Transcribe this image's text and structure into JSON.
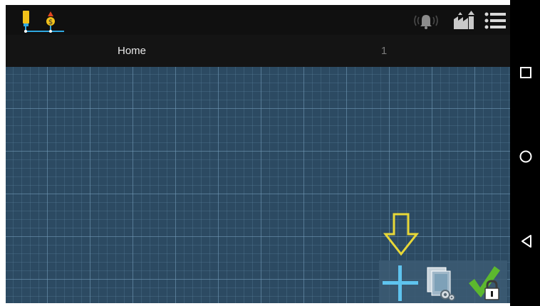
{
  "tabs": [
    {
      "label": "Home",
      "active": true
    },
    {
      "label": "1",
      "active": false
    }
  ],
  "icons": {
    "app_logo": "app-logo-icon",
    "alarm": "bell-alarm-icon",
    "upload": "factory-upload-icon",
    "menu": "menu-list-icon",
    "hint_arrow": "down-arrow-hint-icon",
    "add": "plus-icon",
    "settings": "pages-settings-icon",
    "lock": "check-lock-icon",
    "recents": "square-nav-icon",
    "home": "circle-nav-icon",
    "back": "back-triangle-icon"
  },
  "colors": {
    "canvas": "#2c4a62",
    "topbar": "#101010",
    "tabbar": "#141414",
    "hint_arrow": "#e8d838",
    "plus": "#5ec3ee",
    "check": "#5cb82e",
    "logo_yellow": "#f2c21a",
    "logo_blue": "#2fa7e0"
  }
}
